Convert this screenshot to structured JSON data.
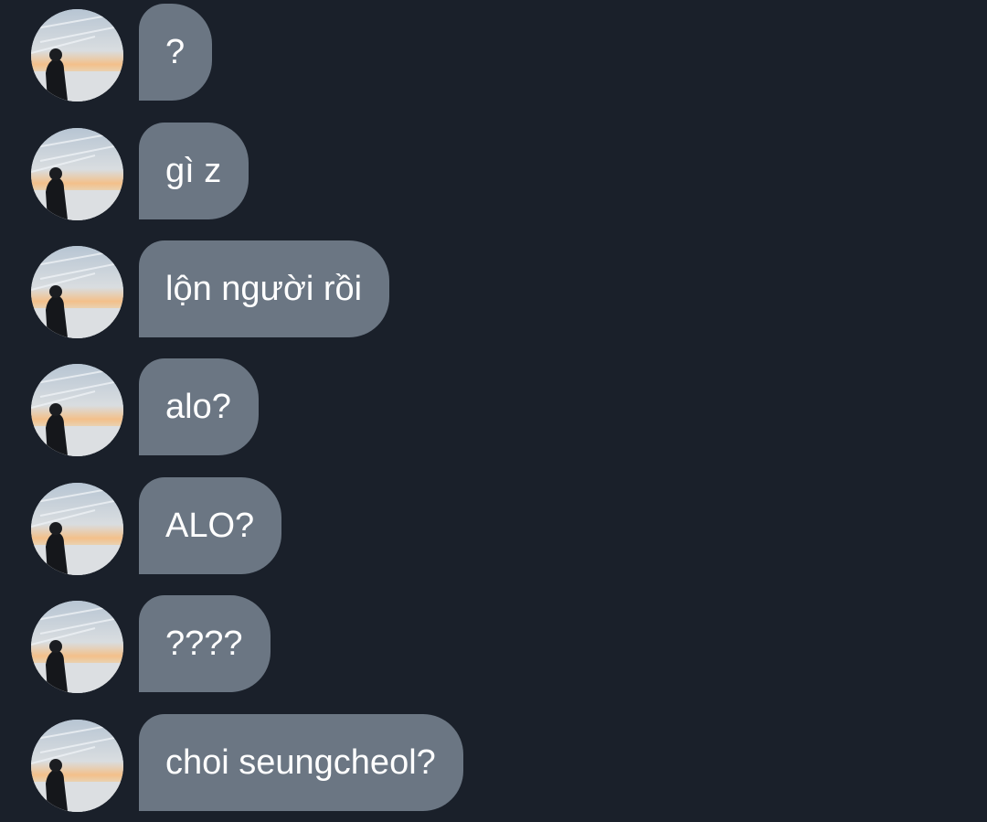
{
  "chat": {
    "messages": [
      {
        "text": "?"
      },
      {
        "text": "gì z"
      },
      {
        "text": "lộn người rồi"
      },
      {
        "text": "alo?"
      },
      {
        "text": "ALO?"
      },
      {
        "text": "????"
      },
      {
        "text": "choi seungcheol?"
      }
    ]
  },
  "colors": {
    "background": "#1a202a",
    "bubble": "#6b7683",
    "text": "#ffffff"
  }
}
